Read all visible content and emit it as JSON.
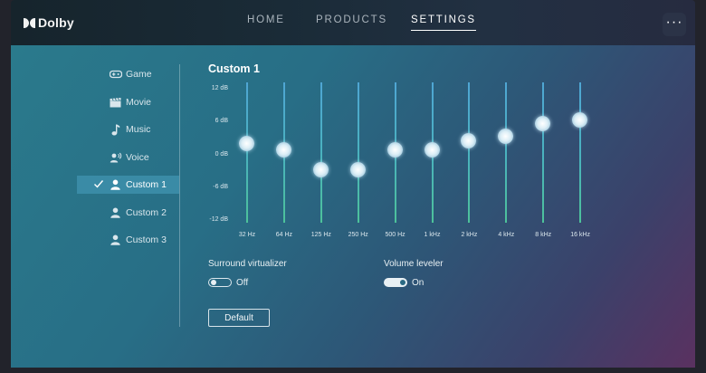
{
  "brand": {
    "name": "Dolby"
  },
  "nav": {
    "items": [
      {
        "label": "HOME"
      },
      {
        "label": "PRODUCTS"
      },
      {
        "label": "SETTINGS",
        "active": true
      }
    ],
    "more_label": "···"
  },
  "sidebar": {
    "items": [
      {
        "label": "Game",
        "icon": "gamepad-icon"
      },
      {
        "label": "Movie",
        "icon": "clapperboard-icon"
      },
      {
        "label": "Music",
        "icon": "music-note-icon"
      },
      {
        "label": "Voice",
        "icon": "voice-icon"
      },
      {
        "label": "Custom 1",
        "icon": "person-icon",
        "selected": true
      },
      {
        "label": "Custom 2",
        "icon": "person-icon"
      },
      {
        "label": "Custom 3",
        "icon": "person-icon"
      }
    ]
  },
  "equalizer": {
    "title": "Custom 1",
    "scale_labels": [
      "12 dB",
      "6 dB",
      "0 dB",
      "-6 dB",
      "-12 dB"
    ],
    "range_db": [
      -12,
      12
    ],
    "bands": [
      {
        "freq": "32 Hz",
        "gain_db": 1.5
      },
      {
        "freq": "64 Hz",
        "gain_db": 0.5
      },
      {
        "freq": "125 Hz",
        "gain_db": -3.0
      },
      {
        "freq": "250 Hz",
        "gain_db": -3.0
      },
      {
        "freq": "500 Hz",
        "gain_db": 0.5
      },
      {
        "freq": "1 kHz",
        "gain_db": 0.5
      },
      {
        "freq": "2 kHz",
        "gain_db": 2.0
      },
      {
        "freq": "4 kHz",
        "gain_db": 2.8
      },
      {
        "freq": "8 kHz",
        "gain_db": 5.0
      },
      {
        "freq": "16 kHz",
        "gain_db": 5.6
      }
    ]
  },
  "options": {
    "surround": {
      "label": "Surround virtualizer",
      "state": "Off",
      "on": false
    },
    "volume": {
      "label": "Volume leveler",
      "state": "On",
      "on": true
    }
  },
  "default_label": "Default"
}
